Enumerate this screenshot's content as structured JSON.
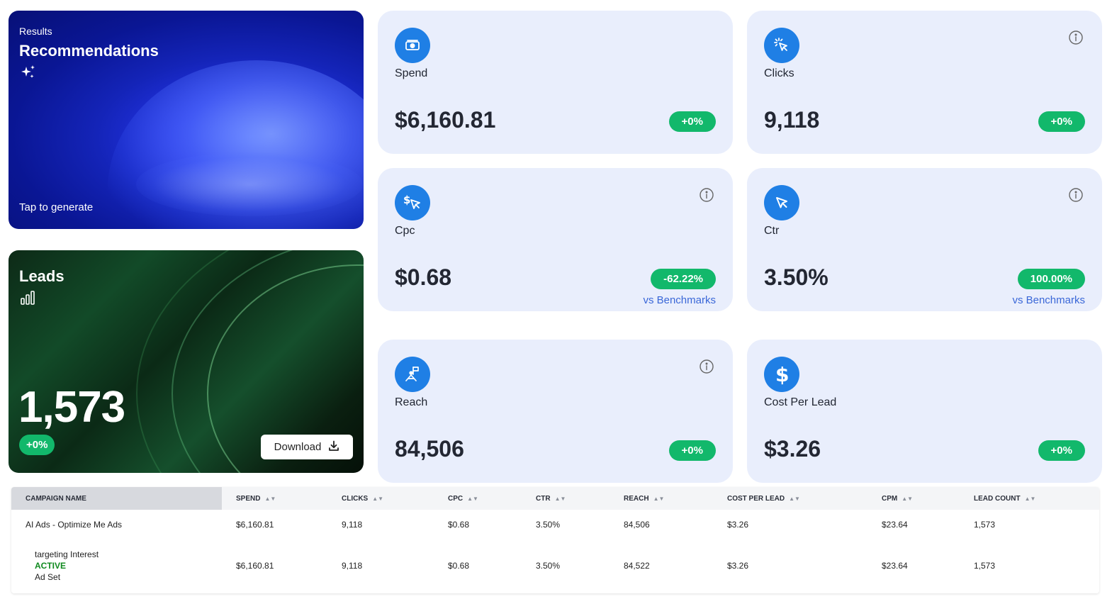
{
  "recommendations": {
    "supertitle": "Results",
    "title": "Recommendations",
    "cta": "Tap to generate"
  },
  "leads": {
    "title": "Leads",
    "value": "1,573",
    "change": "+0%",
    "download_label": "Download"
  },
  "metrics": {
    "spend": {
      "label": "Spend",
      "value": "$6,160.81",
      "change": "+0%"
    },
    "clicks": {
      "label": "Clicks",
      "value": "9,118",
      "change": "+0%"
    },
    "cpc": {
      "label": "Cpc",
      "value": "$0.68",
      "change": "-62.22%",
      "note": "vs Benchmarks"
    },
    "ctr": {
      "label": "Ctr",
      "value": "3.50%",
      "change": "100.00%",
      "note": "vs Benchmarks"
    },
    "reach": {
      "label": "Reach",
      "value": "84,506",
      "change": "+0%"
    },
    "cpl": {
      "label": "Cost Per Lead",
      "value": "$3.26",
      "change": "+0%"
    }
  },
  "table": {
    "headers": [
      "CAMPAIGN NAME",
      "SPEND",
      "CLICKS",
      "CPC",
      "CTR",
      "REACH",
      "COST PER LEAD",
      "CPM",
      "LEAD COUNT"
    ],
    "rows": [
      {
        "name": "AI Ads - Optimize Me Ads",
        "spend": "$6,160.81",
        "clicks": "9,118",
        "cpc": "$0.68",
        "ctr": "3.50%",
        "reach": "84,506",
        "cpl": "$3.26",
        "cpm": "$23.64",
        "leads": "1,573"
      },
      {
        "name": "targeting Interest",
        "status": "ACTIVE",
        "type": "Ad Set",
        "spend": "$6,160.81",
        "clicks": "9,118",
        "cpc": "$0.68",
        "ctr": "3.50%",
        "reach": "84,522",
        "cpl": "$3.26",
        "cpm": "$23.64",
        "leads": "1,573"
      }
    ]
  },
  "colors": {
    "accent_blue": "#1f7fe5",
    "positive_green": "#12b86b",
    "card_bg": "#e9eefc",
    "active_status": "#0f8a1f"
  }
}
